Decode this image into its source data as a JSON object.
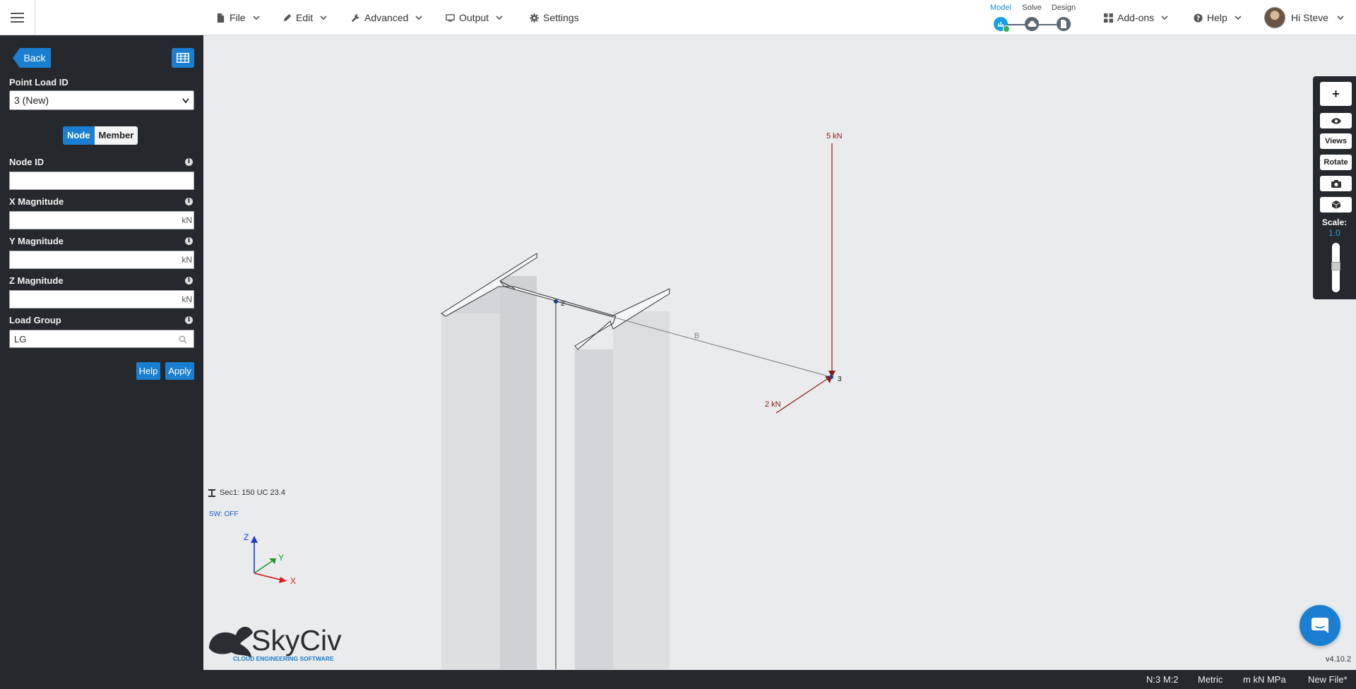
{
  "topbar": {
    "menus": [
      {
        "label": "File",
        "icon": "file-icon"
      },
      {
        "label": "Edit",
        "icon": "pencil-icon"
      },
      {
        "label": "Advanced",
        "icon": "wrench-icon"
      },
      {
        "label": "Output",
        "icon": "monitor-icon"
      },
      {
        "label": "Settings",
        "icon": "gear-icon"
      }
    ],
    "workflow": {
      "steps": [
        "Model",
        "Solve",
        "Design"
      ],
      "active": "Model"
    },
    "addons_label": "Add-ons",
    "help_label": "Help",
    "user_label": "Hi Steve"
  },
  "panel": {
    "back_label": "Back",
    "point_load_id_label": "Point Load ID",
    "point_load_id_value": "3 (New)",
    "toggle": {
      "node": "Node",
      "member": "Member",
      "active": "Node"
    },
    "fields": [
      {
        "label": "Node ID",
        "value": "",
        "unit": ""
      },
      {
        "label": "X Magnitude",
        "value": "",
        "unit": "kN"
      },
      {
        "label": "Y Magnitude",
        "value": "",
        "unit": "kN"
      },
      {
        "label": "Z Magnitude",
        "value": "",
        "unit": "kN"
      }
    ],
    "load_group_label": "Load Group",
    "load_group_value": "LG",
    "help_label": "Help",
    "apply_label": "Apply",
    "info_glyph": "i"
  },
  "viewport": {
    "loads": [
      "5 kN",
      "2 kN"
    ],
    "nodes": [
      "2",
      "3"
    ],
    "member_label": "B",
    "section_info": "Sec1: 150 UC 23.4",
    "sw_info": "SW: OFF",
    "axes": [
      "Z",
      "Y",
      "X"
    ],
    "logo_text": "SkyCiv",
    "logo_tagline": "CLOUD ENGINEERING SOFTWARE"
  },
  "right_toolbar": {
    "plus": "+",
    "views_label": "Views",
    "rotate_label": "Rotate",
    "scale_label": "Scale:",
    "scale_value": "1.0",
    "slider_level": 0.5
  },
  "statusbar": {
    "counts": "N:3  M:2",
    "units_system": "Metric",
    "units": "m  kN  MPa",
    "file_label": "New File*"
  },
  "version": "v4.10.2",
  "colors": {
    "accent": "#1a7fd0",
    "panel": "#25282c",
    "load": "#8b1a1a"
  }
}
